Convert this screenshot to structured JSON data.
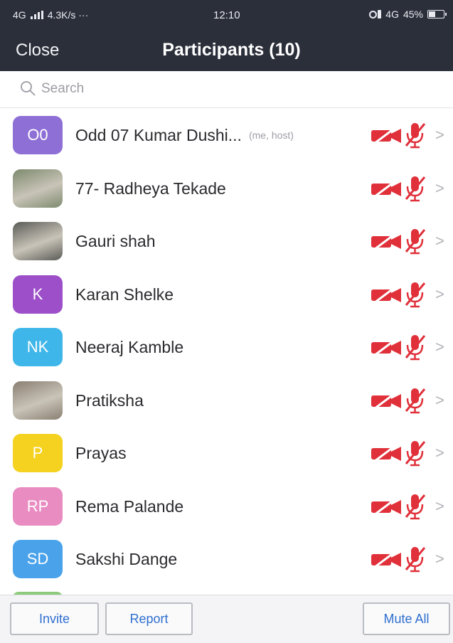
{
  "status_bar": {
    "network": "4G",
    "speed": "4.3K/s ···",
    "time": "12:10",
    "network2": "4G",
    "battery": "45%",
    "battery_level": 0.45
  },
  "header": {
    "close_label": "Close",
    "title": "Participants (10)"
  },
  "search": {
    "placeholder": "Search"
  },
  "participants": [
    {
      "name": "Odd 07 Kumar Dushi...",
      "tag": "(me, host)",
      "initials": "O0",
      "avatar_color": "#8e6fd6",
      "photo": false
    },
    {
      "name": "77- Radheya Tekade",
      "tag": "",
      "initials": "",
      "avatar_color": "#7d8a6e",
      "photo": true
    },
    {
      "name": "Gauri shah",
      "tag": "",
      "initials": "",
      "avatar_color": "#5a5b57",
      "photo": true
    },
    {
      "name": "Karan Shelke",
      "tag": "",
      "initials": "K",
      "avatar_color": "#9c4fc9",
      "photo": false
    },
    {
      "name": "Neeraj Kamble",
      "tag": "",
      "initials": "NK",
      "avatar_color": "#3fb6ea",
      "photo": false
    },
    {
      "name": "Pratiksha",
      "tag": "",
      "initials": "",
      "avatar_color": "#8a7f72",
      "photo": true
    },
    {
      "name": "Prayas",
      "tag": "",
      "initials": "P",
      "avatar_color": "#f4d21f",
      "photo": false
    },
    {
      "name": "Rema Palande",
      "tag": "",
      "initials": "RP",
      "avatar_color": "#e98cc2",
      "photo": false
    },
    {
      "name": "Sakshi Dange",
      "tag": "",
      "initials": "SD",
      "avatar_color": "#4aa3ea",
      "photo": false
    }
  ],
  "footer": {
    "invite_label": "Invite",
    "report_label": "Report",
    "mute_all_label": "Mute All"
  },
  "colors": {
    "header_bg": "#2b2f3a",
    "muted_icon": "#e0303a",
    "button_text": "#2f6fcf"
  }
}
